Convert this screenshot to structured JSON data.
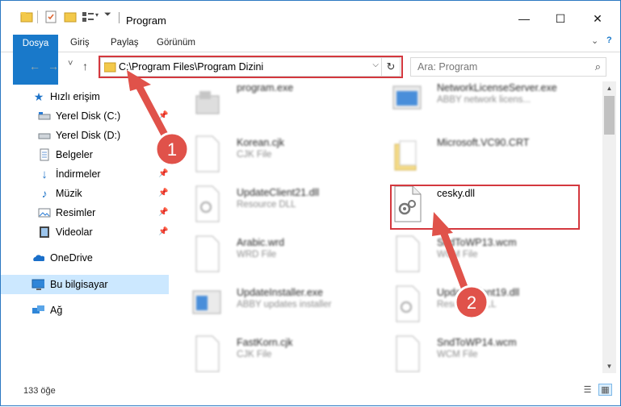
{
  "window": {
    "title": "Program",
    "minimize": "—",
    "maximize": "☐",
    "close": "✕"
  },
  "ribbon": {
    "tabs": [
      "Dosya",
      "Giriş",
      "Paylaş",
      "Görünüm"
    ]
  },
  "navbar": {
    "back": "←",
    "forward": "→",
    "recent": "˅",
    "up": "↑",
    "address": "C:\\Program Files\\Program Dizini",
    "search_placeholder": "Ara: Program"
  },
  "sidebar": {
    "items": [
      {
        "label": "Hızlı erişim",
        "icon": "star-icon",
        "pinned": false
      },
      {
        "label": "Yerel Disk (C:)",
        "icon": "drive-icon",
        "pinned": true
      },
      {
        "label": "Yerel Disk (D:)",
        "icon": "drive-icon",
        "pinned": false
      },
      {
        "label": "Belgeler",
        "icon": "documents-icon",
        "pinned": true
      },
      {
        "label": "İndirmeler",
        "icon": "download-icon",
        "pinned": true
      },
      {
        "label": "Müzik",
        "icon": "music-icon",
        "pinned": true
      },
      {
        "label": "Resimler",
        "icon": "pictures-icon",
        "pinned": true
      },
      {
        "label": "Videolar",
        "icon": "videos-icon",
        "pinned": true
      },
      {
        "label": "OneDrive",
        "icon": "onedrive-icon",
        "pinned": false
      },
      {
        "label": "Bu bilgisayar",
        "icon": "computer-icon",
        "pinned": false
      },
      {
        "label": "Ağ",
        "icon": "network-icon",
        "pinned": false
      }
    ]
  },
  "files": {
    "left": [
      {
        "name": "program.exe",
        "type": "",
        "icon": "exe-icon"
      },
      {
        "name": "Korean.cjk",
        "type": "CJK File",
        "icon": "file-icon"
      },
      {
        "name": "UpdateClient21.dll",
        "type": "Resource DLL",
        "icon": "dll-icon"
      },
      {
        "name": "Arabic.wrd",
        "type": "WRD File",
        "icon": "file-icon"
      },
      {
        "name": "UpdateInstaller.exe",
        "type": "ABBY updates installer",
        "icon": "exe-icon"
      },
      {
        "name": "FastKorn.cjk",
        "type": "CJK File",
        "icon": "file-icon"
      }
    ],
    "right": [
      {
        "name": "NetworkLicenseServer.exe",
        "type": "ABBY network licens...",
        "icon": "exe-icon"
      },
      {
        "name": "Microsoft.VC90.CRT",
        "type": "",
        "icon": "folder-icon"
      },
      {
        "name": "cesky.dll",
        "type": "",
        "icon": "dll-icon"
      },
      {
        "name": "SndToWP13.wcm",
        "type": "WCM File",
        "icon": "file-icon"
      },
      {
        "name": "UpdateClient19.dll",
        "type": "Resource DLL",
        "icon": "dll-icon"
      },
      {
        "name": "SndToWP14.wcm",
        "type": "WCM File",
        "icon": "file-icon"
      }
    ]
  },
  "annotations": {
    "badge1": "1",
    "badge2": "2",
    "color": "#e0524a"
  },
  "status": {
    "count": "133 öğe"
  }
}
